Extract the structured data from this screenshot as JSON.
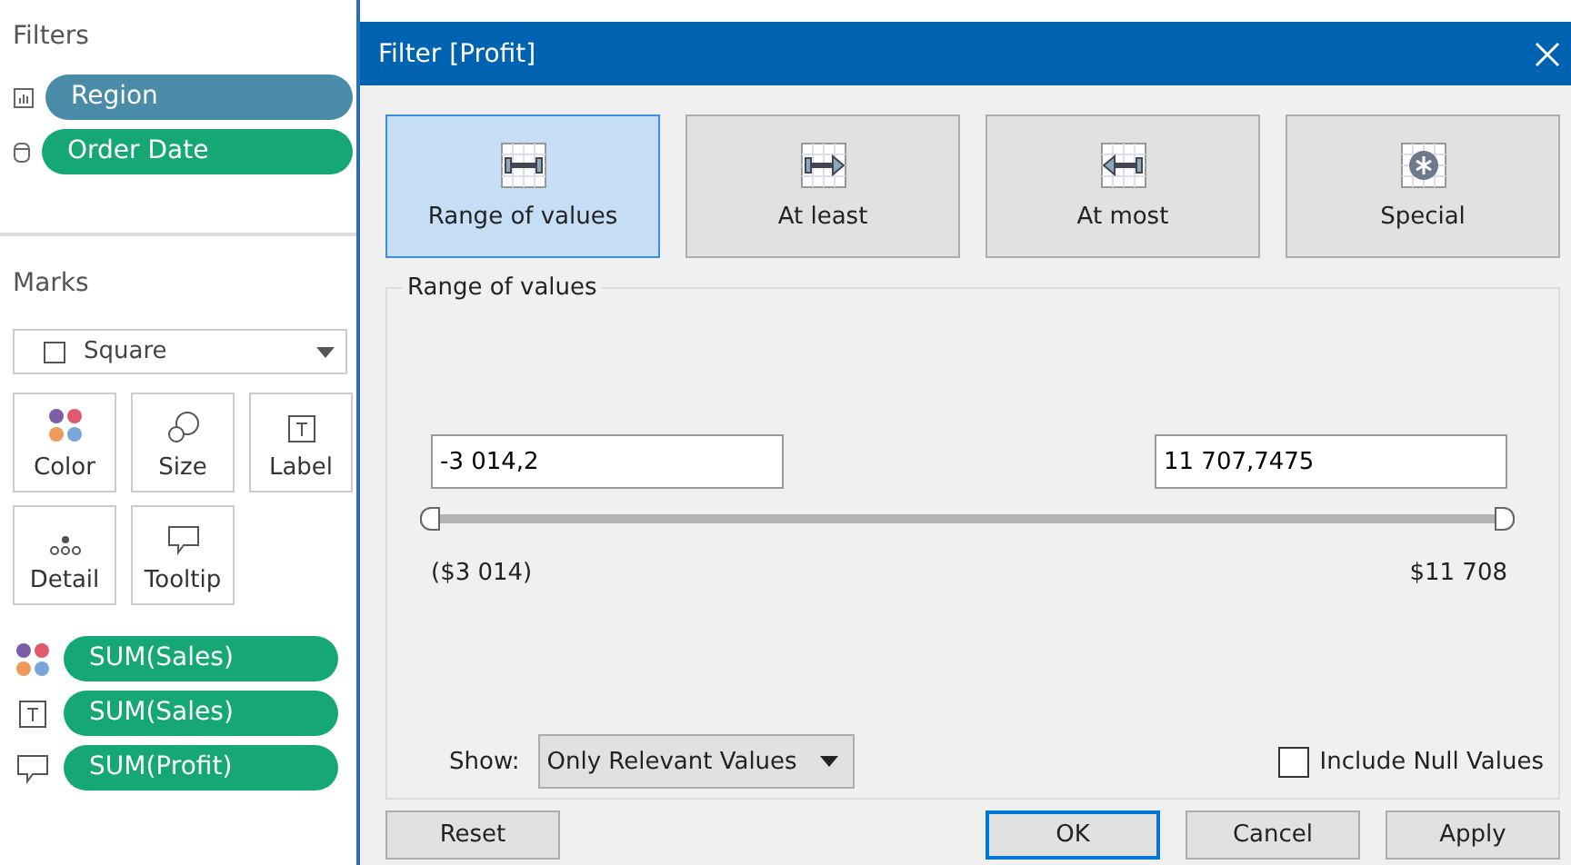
{
  "sidebar": {
    "filters_title": "Filters",
    "filters": [
      {
        "label": "Region",
        "kind": "dimension",
        "color": "#4a8ca8"
      },
      {
        "label": "Order Date",
        "kind": "date",
        "color": "#15a874"
      }
    ],
    "marks_title": "Marks",
    "mark_type": "Square",
    "cards": [
      {
        "label": "Color",
        "kind": "color"
      },
      {
        "label": "Size",
        "kind": "size"
      },
      {
        "label": "Label",
        "kind": "label"
      },
      {
        "label": "Detail",
        "kind": "detail"
      },
      {
        "label": "Tooltip",
        "kind": "tooltip"
      }
    ],
    "mark_fields": [
      {
        "label": "SUM(Sales)",
        "kind": "color",
        "color": "#15a874"
      },
      {
        "label": "SUM(Sales)",
        "kind": "label",
        "color": "#15a874"
      },
      {
        "label": "SUM(Profit)",
        "kind": "tooltip",
        "color": "#15a874"
      }
    ]
  },
  "dialog": {
    "title": "Filter [Profit]",
    "modes": [
      {
        "label": "Range of values",
        "kind": "range",
        "selected": true
      },
      {
        "label": "At least",
        "kind": "least",
        "selected": false
      },
      {
        "label": "At most",
        "kind": "most",
        "selected": false
      },
      {
        "label": "Special",
        "kind": "special",
        "selected": false
      }
    ],
    "group_title": "Range of values",
    "min_value": "-3 014,2",
    "max_value": "11 707,7475",
    "thumbs": [
      {
        "level": 0
      },
      {
        "level": 1
      }
    ],
    "min_label": "($3 014)",
    "max_label": "$11 708",
    "show_label": "Show:",
    "show_value": "Only Relevant Values",
    "include_null": {
      "label": "Include Null Values",
      "checked": false
    },
    "buttons": [
      {
        "label": "Reset",
        "kind": "left",
        "selected": false
      },
      {
        "label": "OK",
        "kind": "right",
        "selected": true
      },
      {
        "label": "Cancel",
        "kind": "right",
        "selected": false
      },
      {
        "label": "Apply",
        "kind": "right",
        "selected": false
      }
    ]
  }
}
